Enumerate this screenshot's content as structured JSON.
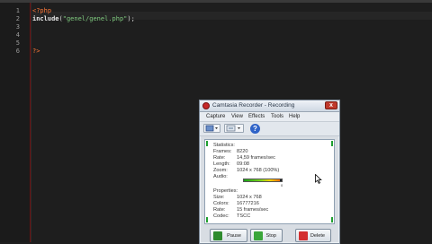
{
  "editor": {
    "line_numbers": [
      "1",
      "2",
      "3",
      "4",
      "5",
      "6"
    ],
    "code": {
      "line1_open": "<?php",
      "line2_func": "include",
      "line2_paren_open": "(",
      "line2_string": "\"genel/genel.php\"",
      "line2_close": ");",
      "line6_close": "?>"
    }
  },
  "recorder": {
    "title": "Camtasia Recorder - Recording",
    "close_label": "x",
    "menu": [
      "Capture",
      "View",
      "Effects",
      "Tools",
      "Help"
    ],
    "help_label": "?",
    "statistics": {
      "heading": "Statistics:",
      "rows": [
        {
          "key": "Frames:",
          "value": "8220"
        },
        {
          "key": "Rate:",
          "value": "14,59 frames/sec"
        },
        {
          "key": "Length:",
          "value": "09:08"
        },
        {
          "key": "Zoom:",
          "value": "1024 x 768 (100%)"
        },
        {
          "key": "Audio:",
          "value": ""
        }
      ],
      "audio_level": 0.95,
      "audio_tick": "0"
    },
    "properties": {
      "heading": "Properties:",
      "rows": [
        {
          "key": "Size:",
          "value": "1024 x 768"
        },
        {
          "key": "Colors:",
          "value": "16777216"
        },
        {
          "key": "Rate:",
          "value": "15 frames/sec"
        },
        {
          "key": "Codec:",
          "value": "TSCC"
        }
      ]
    },
    "buttons": {
      "pause": "Pause",
      "stop": "Stop",
      "delete": "Delete"
    },
    "colors": {
      "pause_icon": "#2e8b2e",
      "stop_icon": "#3aa63a",
      "delete_icon": "#d32f2f"
    }
  }
}
